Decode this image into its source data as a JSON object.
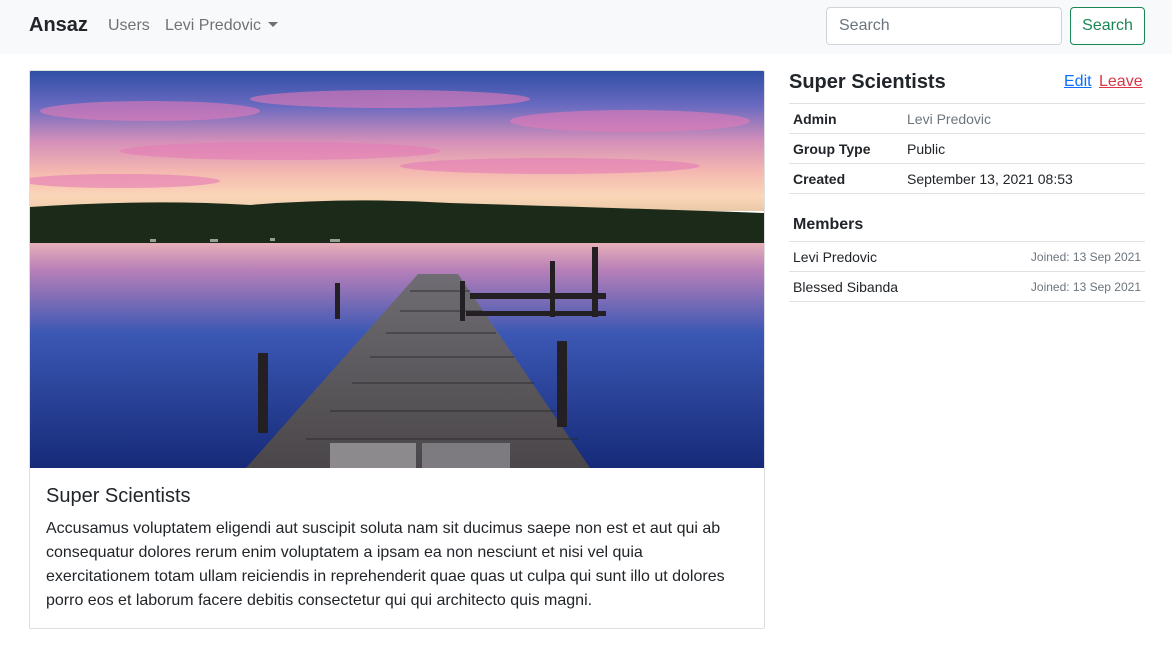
{
  "navbar": {
    "brand": "Ansaz",
    "users_link": "Users",
    "user_menu": "Levi Predovic",
    "search_placeholder": "Search",
    "search_button": "Search"
  },
  "card": {
    "image": "lake-sunset-pier",
    "title": "Super Scientists",
    "description": "Accusamus voluptatem eligendi aut suscipit soluta nam sit ducimus saepe non est et aut qui ab consequatur dolores rerum enim voluptatem a ipsam ea non nesciunt et nisi vel quia exercitationem totam ullam reiciendis in reprehenderit quae quas ut culpa qui sunt illo ut dolores porro eos et laborum facere debitis consectetur qui qui architecto quis magni."
  },
  "group": {
    "title": "Super Scientists",
    "edit_label": "Edit",
    "leave_label": "Leave",
    "details": [
      {
        "key": "Admin",
        "value": "Levi Predovic"
      },
      {
        "key": "Group Type",
        "value": "Public"
      },
      {
        "key": "Created",
        "value": "September 13, 2021 08:53"
      }
    ],
    "members_title": "Members",
    "members": [
      {
        "name": "Levi Predovic",
        "joined": "Joined: 13 Sep 2021"
      },
      {
        "name": "Blessed Sibanda",
        "joined": "Joined: 13 Sep 2021"
      }
    ]
  },
  "colors": {
    "link": "#0d6efd",
    "danger": "#dc3545",
    "success": "#198754",
    "navbar_bg": "#f8f9fa"
  }
}
